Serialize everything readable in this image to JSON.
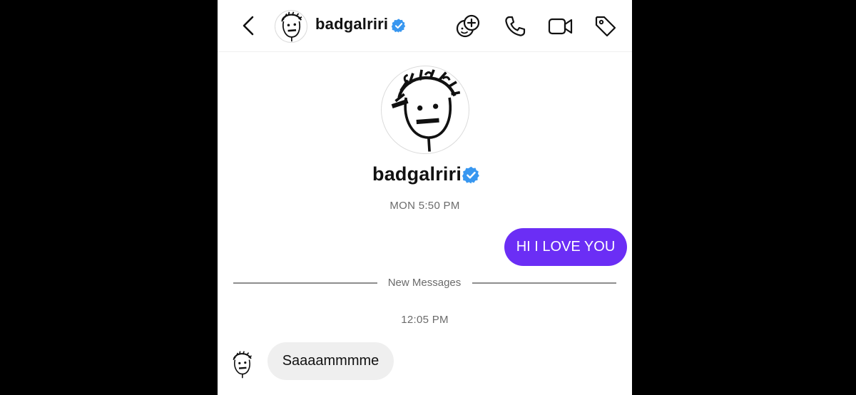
{
  "header": {
    "username": "badgalriri",
    "verified": true,
    "icons": [
      "back-chevron-icon",
      "add-emoji-icon",
      "phone-icon",
      "video-camera-icon",
      "tag-icon"
    ]
  },
  "profile": {
    "username": "badgalriri",
    "verified": true
  },
  "conversation": {
    "first_timestamp": "MON 5:50 PM",
    "outgoing_message": "HI I LOVE YOU",
    "divider_label": "New Messages",
    "second_timestamp": "12:05 PM",
    "incoming_message": "Saaaammmme"
  },
  "colors": {
    "outgoing_bubble": "#6b2ef5",
    "incoming_bubble": "#efefef",
    "verified_badge": "#3897f0",
    "letterbox": "#000000"
  }
}
